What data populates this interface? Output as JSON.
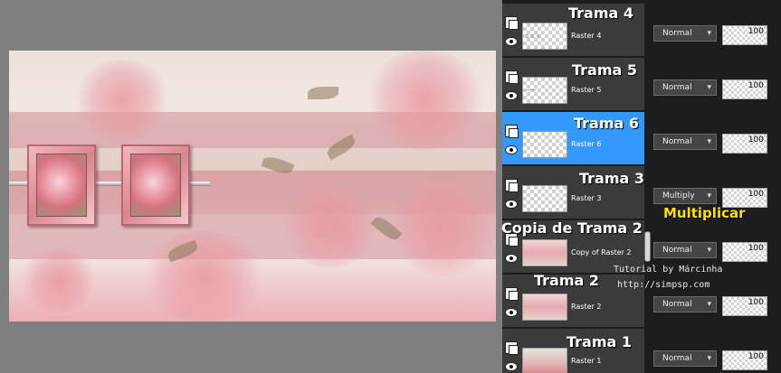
{
  "canvas": {
    "title": "composed pink floral tag preview"
  },
  "layers": [
    {
      "id": "trama4",
      "overlay_title": "Trama 4",
      "name": "Raster 4",
      "blend": "Normal",
      "opacity": "100",
      "thumb": "transparent",
      "thumb_mark": "s c c",
      "selected": false
    },
    {
      "id": "trama5",
      "overlay_title": "Trama 5",
      "name": "Raster 5",
      "blend": "Normal",
      "opacity": "100",
      "thumb": "transparent",
      "thumb_mark": "~~",
      "selected": false
    },
    {
      "id": "trama6",
      "overlay_title": "Trama 6",
      "name": "Raster 6",
      "blend": "Normal",
      "opacity": "100",
      "thumb": "transparent",
      "thumb_mark": "",
      "selected": true
    },
    {
      "id": "trama3",
      "overlay_title": "Trama 3",
      "name": "Raster 3",
      "blend": "Multiply",
      "opacity": "100",
      "thumb": "transparent",
      "thumb_mark": "",
      "selected": false
    },
    {
      "id": "copia2",
      "overlay_title": "Copia de Trama 2",
      "name": "Copy of Raster 2",
      "blend": "Normal",
      "opacity": "100",
      "thumb": "pink",
      "thumb_mark": "",
      "selected": false
    },
    {
      "id": "trama2",
      "overlay_title": "Trama 2",
      "name": "Raster 2",
      "blend": "Normal",
      "opacity": "100",
      "thumb": "pink",
      "thumb_mark": "",
      "selected": false
    },
    {
      "id": "trama1",
      "overlay_title": "Trama 1",
      "name": "Raster 1",
      "blend": "Normal",
      "opacity": "100",
      "thumb": "bg",
      "thumb_mark": "",
      "selected": false
    }
  ],
  "annotations": {
    "multiplicar": "Multiplicar",
    "tutorial_by": "Tutorial by Márcinha",
    "site": "http://simpsp.com"
  },
  "colors": {
    "panel_bg": "#1d1d1d",
    "row_bg": "#3b3b3b",
    "selected_row": "#3399ff",
    "annotation_yellow": "#ffe100",
    "desktop_bg": "#7f7f7f"
  }
}
